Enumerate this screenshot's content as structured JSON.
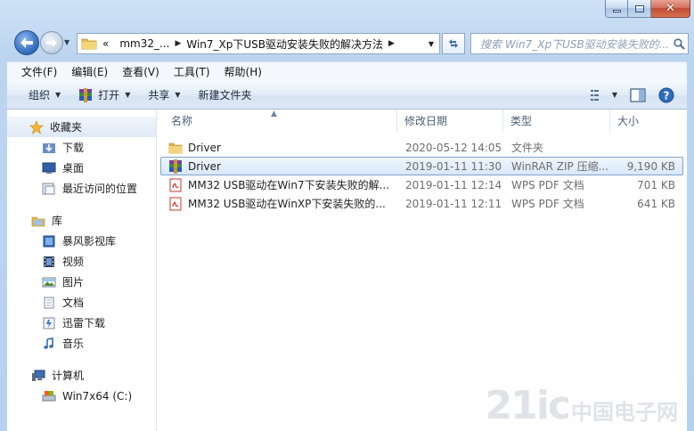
{
  "window": {
    "caption": {
      "minimize_icon": "minimize-icon",
      "maximize_icon": "maximize-icon",
      "close_icon": "close-icon"
    }
  },
  "nav": {
    "breadcrumb": [
      {
        "label": "«"
      },
      {
        "label": "mm32_..."
      },
      {
        "label": "Win7_Xp下USB驱动安装失败的解决方法"
      }
    ],
    "search_placeholder": "搜索 Win7_Xp下USB驱动安装失败的..."
  },
  "menubar": [
    {
      "label": "文件(F)"
    },
    {
      "label": "编辑(E)"
    },
    {
      "label": "查看(V)"
    },
    {
      "label": "工具(T)"
    },
    {
      "label": "帮助(H)"
    }
  ],
  "toolbar": {
    "organize": "组织",
    "open": "打开",
    "share": "共享",
    "new_folder": "新建文件夹"
  },
  "sidebar": {
    "favorites": {
      "label": "收藏夹",
      "items": [
        {
          "label": "下载",
          "icon": "download-folder-icon"
        },
        {
          "label": "桌面",
          "icon": "desktop-icon"
        },
        {
          "label": "最近访问的位置",
          "icon": "recent-places-icon"
        }
      ]
    },
    "libraries": {
      "label": "库",
      "items": [
        {
          "label": "暴风影视库",
          "icon": "video-library-icon"
        },
        {
          "label": "视频",
          "icon": "video-icon"
        },
        {
          "label": "图片",
          "icon": "picture-icon"
        },
        {
          "label": "文档",
          "icon": "document-icon"
        },
        {
          "label": "迅雷下载",
          "icon": "thunder-download-icon"
        },
        {
          "label": "音乐",
          "icon": "music-icon"
        }
      ]
    },
    "computer": {
      "label": "计算机",
      "items": [
        {
          "label": "Win7x64 (C:)",
          "icon": "drive-icon"
        }
      ]
    }
  },
  "columns": {
    "name": "名称",
    "date": "修改日期",
    "type": "类型",
    "size": "大小"
  },
  "files": [
    {
      "name": "Driver",
      "date": "2020-05-12 14:05",
      "type": "文件夹",
      "size": "",
      "icon": "folder-icon",
      "selected": false
    },
    {
      "name": "Driver",
      "date": "2019-01-11 11:30",
      "type": "WinRAR ZIP 压缩...",
      "size": "9,190 KB",
      "icon": "winrar-icon",
      "selected": true
    },
    {
      "name": "MM32 USB驱动在Win7下安装失败的解...",
      "date": "2019-01-11 12:14",
      "type": "WPS PDF 文档",
      "size": "701 KB",
      "icon": "pdf-icon",
      "selected": false
    },
    {
      "name": "MM32 USB驱动在WinXP下安装失败的...",
      "date": "2019-01-11 12:11",
      "type": "WPS PDF 文档",
      "size": "641 KB",
      "icon": "pdf-icon",
      "selected": false
    }
  ],
  "watermark": {
    "main": "21ic",
    "sub": "中国电子网"
  }
}
